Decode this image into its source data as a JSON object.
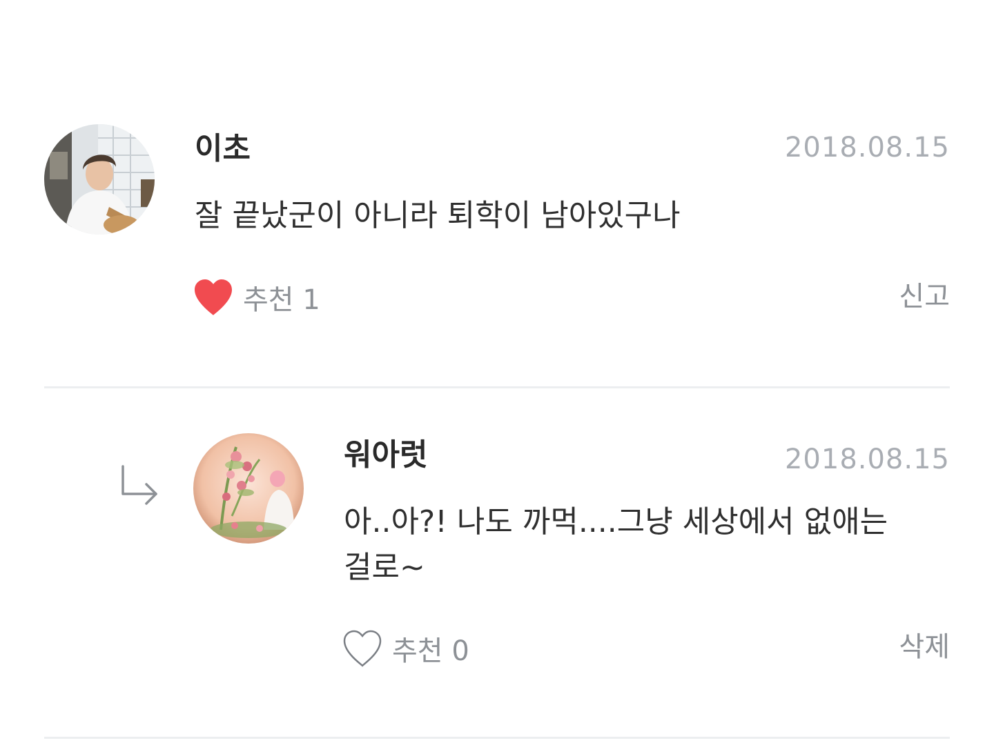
{
  "comments": [
    {
      "username": "이초",
      "date": "2018.08.15",
      "text": "잘 끝났군이 아니라 퇴학이 남아있구나",
      "like_label": "추천",
      "like_count": "1",
      "liked": true,
      "action_label": "신고",
      "avatar": "photo-avatar"
    },
    {
      "username": "워아럿",
      "date": "2018.08.15",
      "text": "아..아?! 나도 까먹....그냥 세상에서 없애는 걸로~",
      "like_label": "추천",
      "like_count": "0",
      "liked": false,
      "action_label": "삭제",
      "avatar": "flower-photo-avatar",
      "is_reply": true
    }
  ],
  "colors": {
    "heart_filled": "#f14b50",
    "heart_outline": "#7a7e84",
    "date": "#a9adb3",
    "divider": "#eceef0"
  },
  "icons": {
    "like_filled": "heart-filled-icon",
    "like_empty": "heart-outline-icon",
    "reply": "reply-arrow-icon"
  }
}
